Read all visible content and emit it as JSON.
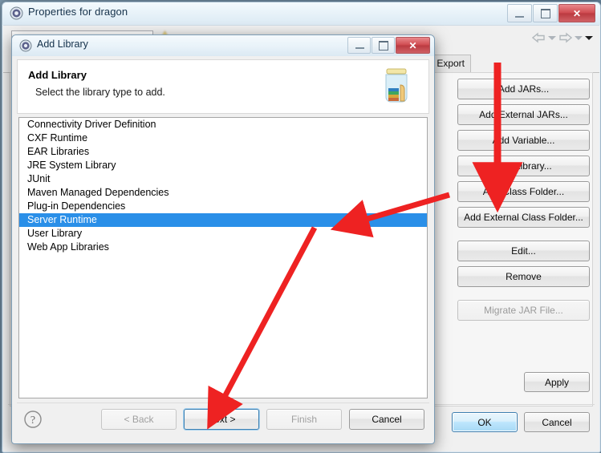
{
  "background_window": {
    "title": "Properties for dragon",
    "icon": "properties-gear-icon",
    "window_controls": [
      "minimize",
      "restore",
      "close"
    ],
    "nav": {
      "back_icon": "back-arrow-icon",
      "back_caret": "chevron-down-icon",
      "forward_icon": "forward-arrow-icon",
      "forward_caret": "chevron-down-icon",
      "menu_caret": "chevron-down-icon"
    },
    "tabs": [
      {
        "label": "Export"
      }
    ],
    "buttons": [
      {
        "label": "Add JARs...",
        "disabled": false
      },
      {
        "label": "Add External JARs...",
        "disabled": false
      },
      {
        "label": "Add Variable...",
        "disabled": false
      },
      {
        "label": "Add Library...",
        "disabled": false
      },
      {
        "label": "Add Class Folder...",
        "disabled": false
      },
      {
        "label": "Add External Class Folder...",
        "disabled": false
      },
      {
        "label": "Edit...",
        "disabled": false
      },
      {
        "label": "Remove",
        "disabled": false
      },
      {
        "label": "Migrate JAR File...",
        "disabled": true
      }
    ],
    "apply_label": "Apply",
    "ok_label": "OK",
    "cancel_label": "Cancel"
  },
  "dialog": {
    "title": "Add Library",
    "icon": "add-library-gear-icon",
    "window_controls": [
      "minimize",
      "restore",
      "close"
    ],
    "header": {
      "heading": "Add Library",
      "subtitle": "Select the library type to add.",
      "icon": "jar-with-books-icon"
    },
    "list": {
      "items": [
        {
          "label": "Connectivity Driver Definition",
          "selected": false
        },
        {
          "label": "CXF Runtime",
          "selected": false
        },
        {
          "label": "EAR Libraries",
          "selected": false
        },
        {
          "label": "JRE System Library",
          "selected": false
        },
        {
          "label": "JUnit",
          "selected": false
        },
        {
          "label": "Maven Managed Dependencies",
          "selected": false
        },
        {
          "label": "Plug-in Dependencies",
          "selected": false
        },
        {
          "label": "Server Runtime",
          "selected": true
        },
        {
          "label": "User Library",
          "selected": false
        },
        {
          "label": "Web App Libraries",
          "selected": false
        }
      ],
      "selected_value": "Server Runtime"
    },
    "help_icon": "help-question-icon",
    "wizard_buttons": [
      {
        "label": "< Back",
        "disabled": true,
        "focused": false
      },
      {
        "label": "Next >",
        "disabled": false,
        "focused": true
      },
      {
        "label": "Finish",
        "disabled": true,
        "focused": false
      },
      {
        "label": "Cancel",
        "disabled": false,
        "focused": false
      }
    ]
  },
  "annotations": {
    "color": "#ee2222",
    "arrows": [
      {
        "name": "arrow-to-add-library-button",
        "target": "Add Library..."
      },
      {
        "name": "arrow-to-server-runtime-row",
        "target": "Server Runtime"
      },
      {
        "name": "arrow-to-next-button",
        "target": "Next >"
      }
    ]
  },
  "colors": {
    "selection_blue": "#2a8fe8",
    "annotation_red": "#ee2222",
    "close_red": "#cf4b50",
    "focus_blue": "#3c7fb1"
  }
}
